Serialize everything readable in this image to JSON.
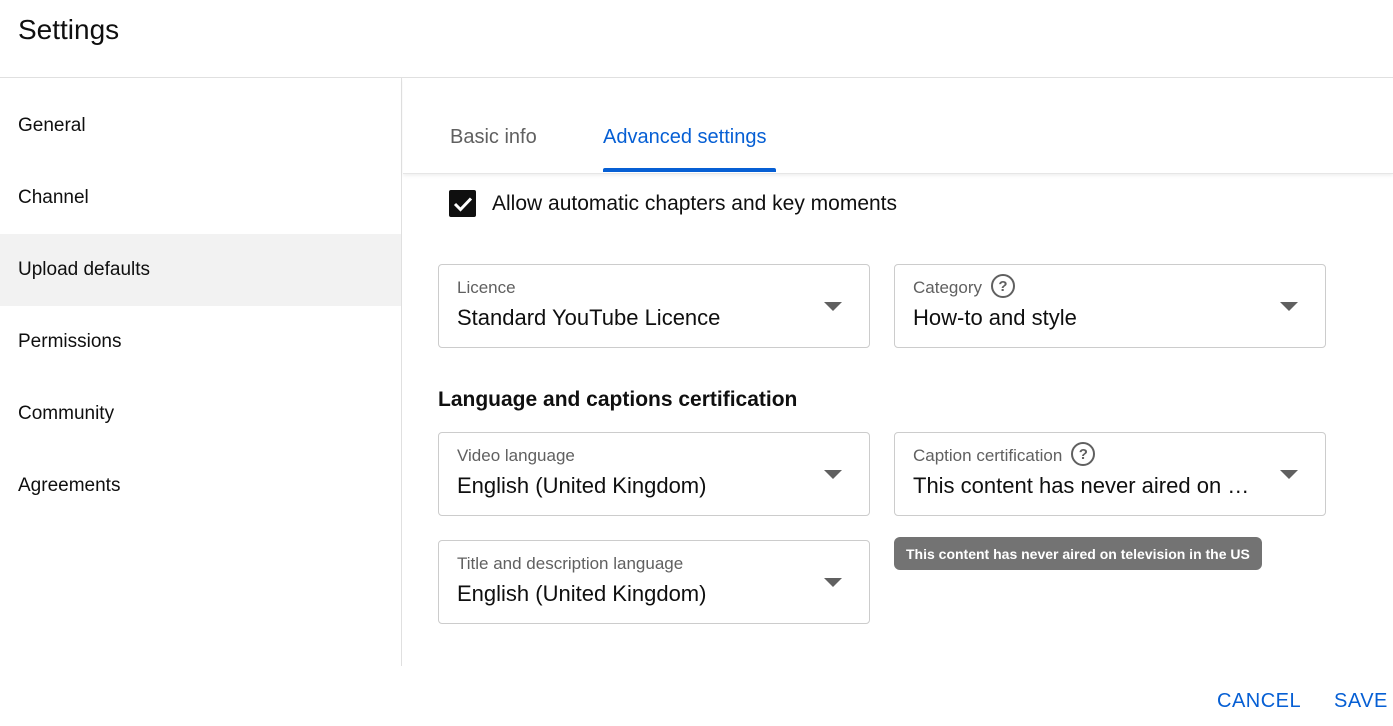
{
  "header": {
    "title": "Settings"
  },
  "sidebar": {
    "items": [
      {
        "label": "General"
      },
      {
        "label": "Channel"
      },
      {
        "label": "Upload defaults"
      },
      {
        "label": "Permissions"
      },
      {
        "label": "Community"
      },
      {
        "label": "Agreements"
      }
    ],
    "active": "Upload defaults"
  },
  "tabs": [
    {
      "label": "Basic info"
    },
    {
      "label": "Advanced settings"
    }
  ],
  "active_tab": "Advanced settings",
  "chapters": {
    "label": "Allow automatic chapters and key moments",
    "checked": true
  },
  "licence": {
    "label": "Licence",
    "value": "Standard YouTube Licence"
  },
  "category": {
    "label": "Category",
    "value": "How-to and style"
  },
  "language_section": {
    "title": "Language and captions certification"
  },
  "video_language": {
    "label": "Video language",
    "value": "English (United Kingdom)"
  },
  "caption_certification": {
    "label": "Caption certification",
    "value": "This content has never aired on …"
  },
  "title_language": {
    "label": "Title and description language",
    "value": "English (United Kingdom)"
  },
  "tooltip": {
    "text": "This content has never aired on television in the US"
  },
  "footer": {
    "cancel_label": "CANCEL",
    "save_label": "SAVE"
  },
  "colors": {
    "accent": "#065fd4",
    "text": "#0f0f0f",
    "secondary_text": "#606060",
    "active_bg": "#f2f2f2",
    "tooltip_bg": "#737373"
  }
}
